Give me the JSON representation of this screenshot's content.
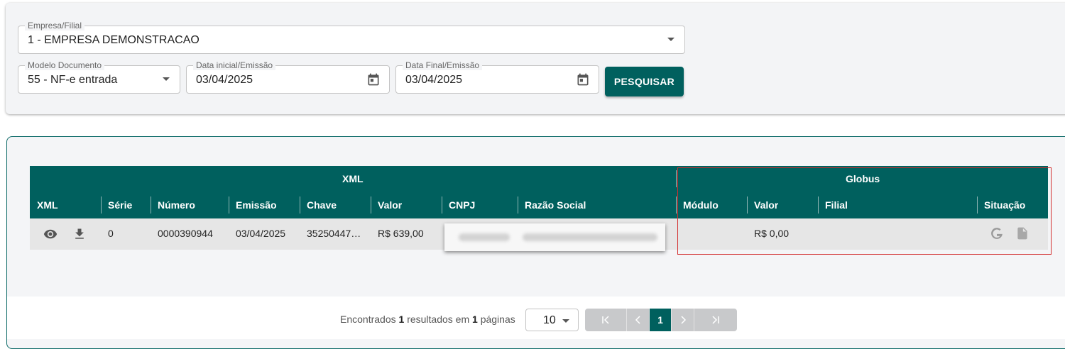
{
  "filters": {
    "empresa": {
      "label": "Empresa/Filial",
      "value": "1 - EMPRESA DEMONSTRACAO"
    },
    "modelo": {
      "label": "Modelo Documento",
      "value": "55 - NF-e entrada"
    },
    "data_inicial": {
      "label": "Data inicial/Emissão",
      "value": "03/04/2025"
    },
    "data_final": {
      "label": "Data Final/Emissão",
      "value": "03/04/2025"
    },
    "search_label": "PESQUISAR"
  },
  "table": {
    "group_xml": "XML",
    "group_globus": "Globus",
    "columns": {
      "xml": "XML",
      "serie": "Série",
      "numero": "Número",
      "emissao": "Emissão",
      "chave": "Chave",
      "valor": "Valor",
      "cnpj": "CNPJ",
      "razao": "Razão Social",
      "modulo": "Módulo",
      "valor_globus": "Valor",
      "filial": "Filial",
      "situacao": "Situação"
    },
    "rows": [
      {
        "serie": "0",
        "numero": "0000390944",
        "emissao": "03/04/2025",
        "chave": "35250447…",
        "valor": "R$ 639,00",
        "modulo": "",
        "valor_globus": "R$ 0,00",
        "filial": ""
      }
    ]
  },
  "pagination": {
    "prefix": "Encontrados",
    "count": "1",
    "mid1": "resultados em",
    "pages": "1",
    "suffix": "páginas",
    "per_page": "10",
    "current": "1"
  },
  "colors": {
    "primary": "#00605e",
    "highlight": "#d32f2f"
  },
  "icons": [
    "chevron-down-icon",
    "calendar-icon",
    "eye-icon",
    "download-icon",
    "globus-g-icon",
    "document-icon",
    "first-page-icon",
    "prev-page-icon",
    "next-page-icon",
    "last-page-icon"
  ]
}
